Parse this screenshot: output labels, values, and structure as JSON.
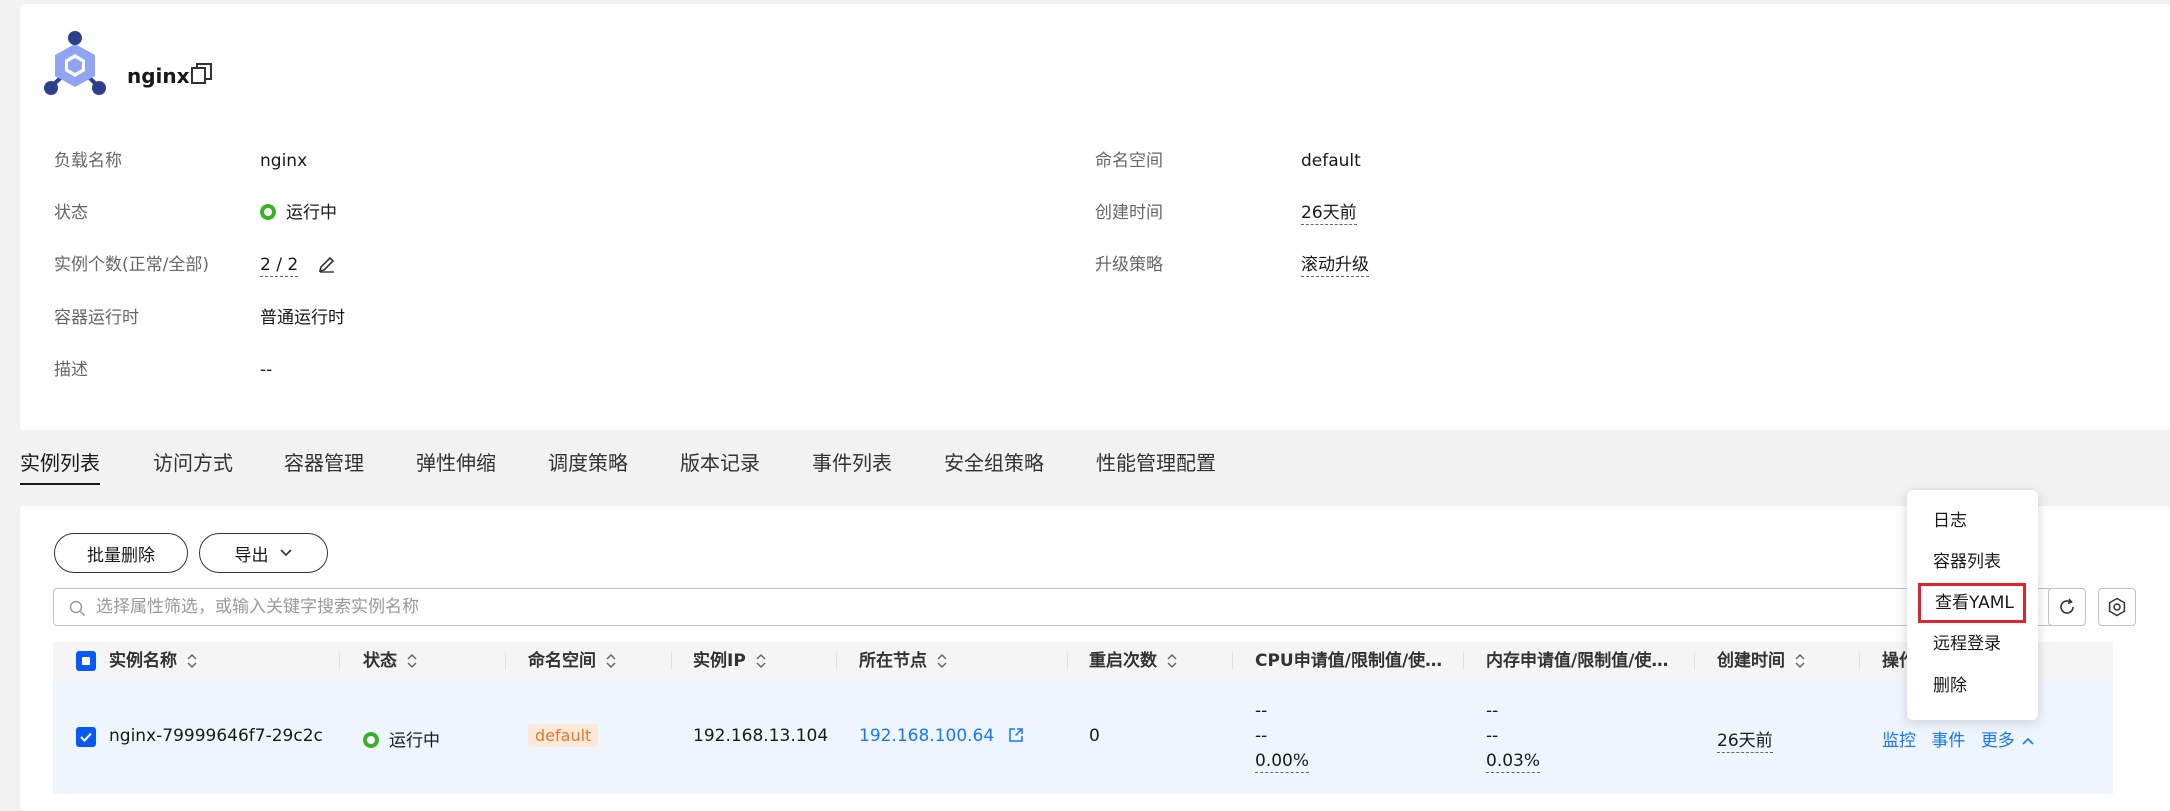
{
  "header": {
    "title": "nginx",
    "colors": {
      "icon_primary": "#2e3f8f",
      "icon_secondary": "#8fa4f2"
    }
  },
  "details": {
    "left": [
      {
        "label": "负载名称",
        "value": "nginx"
      },
      {
        "label": "状态",
        "value": "运行中"
      },
      {
        "label": "实例个数(正常/全部)",
        "value": "2 / 2"
      },
      {
        "label": "容器运行时",
        "value": "普通运行时"
      },
      {
        "label": "描述",
        "value": "--"
      }
    ],
    "right": [
      {
        "label": "命名空间",
        "value": "default"
      },
      {
        "label": "创建时间",
        "value": "26天前"
      },
      {
        "label": "升级策略",
        "value": "滚动升级"
      }
    ]
  },
  "tabs": [
    {
      "label": "实例列表",
      "active": true
    },
    {
      "label": "访问方式"
    },
    {
      "label": "容器管理"
    },
    {
      "label": "弹性伸缩"
    },
    {
      "label": "调度策略"
    },
    {
      "label": "版本记录"
    },
    {
      "label": "事件列表"
    },
    {
      "label": "安全组策略"
    },
    {
      "label": "性能管理配置"
    }
  ],
  "toolbar": {
    "batch_delete": "批量删除",
    "export": "导出",
    "search_placeholder": "选择属性筛选，或输入关键字搜索实例名称"
  },
  "table": {
    "columns": [
      "实例名称",
      "状态",
      "命名空间",
      "实例IP",
      "所在节点",
      "重启次数",
      "CPU申请值/限制值/使…",
      "内存申请值/限制值/使…",
      "创建时间",
      "操作"
    ],
    "rows": [
      {
        "name": "nginx-79999646f7-29c2c",
        "status": "运行中",
        "namespace": "default",
        "ip": "192.168.13.104",
        "node": "192.168.100.64",
        "restarts": "0",
        "cpu": [
          "--",
          "--",
          "0.00%"
        ],
        "mem": [
          "--",
          "--",
          "0.03%"
        ],
        "created": "26天前",
        "actions": [
          "监控",
          "事件",
          "更多"
        ]
      }
    ]
  },
  "dropdown": {
    "items": [
      "日志",
      "容器列表",
      "查看YAML",
      "远程登录",
      "删除"
    ],
    "highlighted": "查看YAML"
  }
}
